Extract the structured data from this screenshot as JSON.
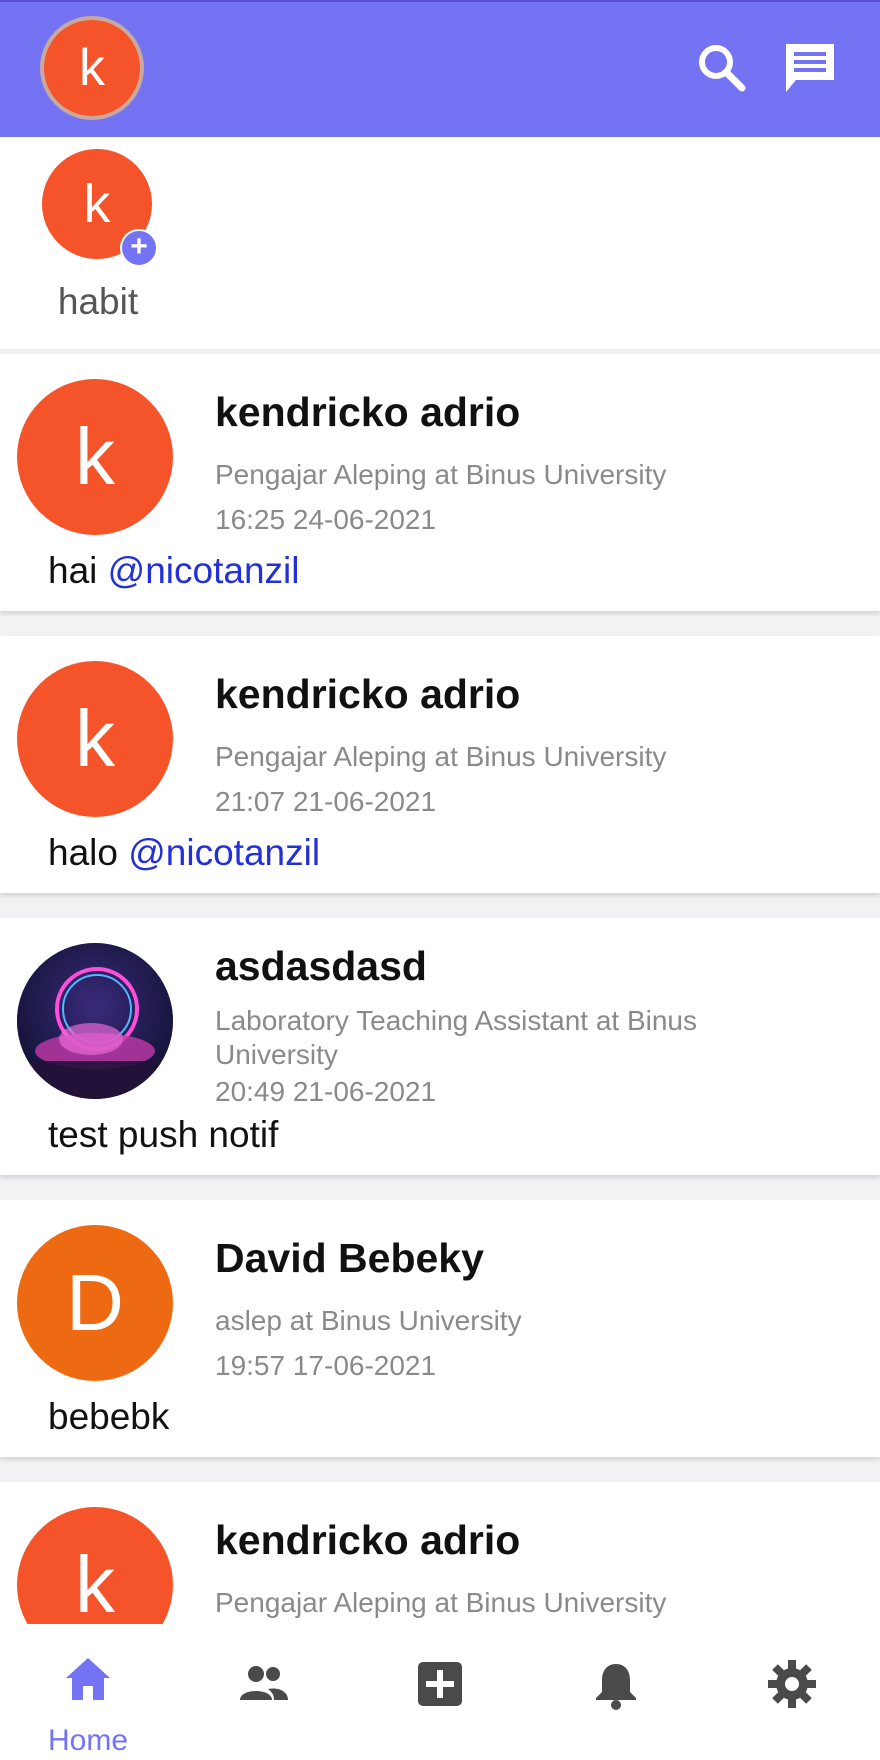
{
  "header": {
    "avatar_letter": "k",
    "icons": [
      "search-icon",
      "chat-icon"
    ],
    "accent": "#7373f3"
  },
  "stories": [
    {
      "letter": "k",
      "label": "habit",
      "add_icon": "+"
    }
  ],
  "posts": [
    {
      "letter": "k",
      "avatar_color": "#f5532a",
      "name": "kendricko adrio",
      "role": "Pengajar Aleping at Binus University",
      "time": "16:25 24-06-2021",
      "text": "hai ",
      "mention": "@nicotanzil"
    },
    {
      "letter": "k",
      "avatar_color": "#f5532a",
      "name": "kendricko adrio",
      "role": "Pengajar Aleping at Binus University",
      "time": "21:07 21-06-2021",
      "text": "halo ",
      "mention": "@nicotanzil"
    },
    {
      "letter": "",
      "avatar_color": "#1a1f4a",
      "name": "asdasdasd",
      "role": "Laboratory Teaching Assistant at Binus University",
      "time": "20:49 21-06-2021",
      "text": "test push notif",
      "mention": ""
    },
    {
      "letter": "D",
      "avatar_color": "#ee6a12",
      "name": "David Bebeky",
      "role": "aslep at Binus University",
      "time": "19:57 17-06-2021",
      "text": "bebebk",
      "mention": ""
    },
    {
      "letter": "k",
      "avatar_color": "#f5532a",
      "name": "kendricko adrio",
      "role": "Pengajar Aleping at Binus University",
      "time": "",
      "text": "",
      "mention": ""
    }
  ],
  "bottom_nav": {
    "items": [
      {
        "icon": "home-icon",
        "label": "Home",
        "active": true
      },
      {
        "icon": "people-icon",
        "label": "",
        "active": false
      },
      {
        "icon": "add-box-icon",
        "label": "",
        "active": false
      },
      {
        "icon": "bell-icon",
        "label": "",
        "active": false
      },
      {
        "icon": "gear-icon",
        "label": "",
        "active": false
      }
    ],
    "active_color": "#7373f3",
    "inactive_color": "#4a4a4a"
  }
}
